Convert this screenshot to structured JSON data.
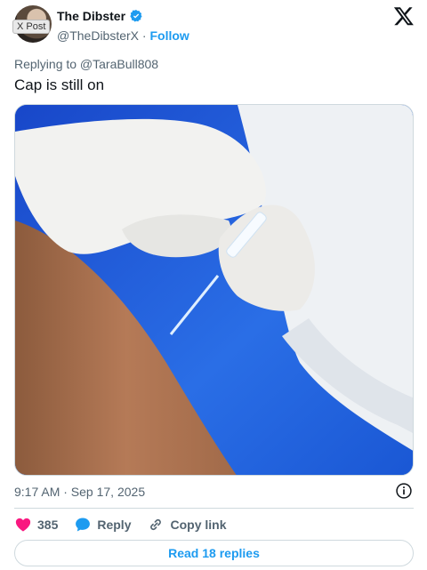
{
  "badge": "X Post",
  "author": {
    "display_name": "The Dibster",
    "handle": "@TheDibsterX",
    "separator": "·",
    "follow_label": "Follow"
  },
  "post": {
    "replying_to": "Replying to @TaraBull808",
    "text": "Cap is still on",
    "timestamp": "9:17 AM · Sep 17, 2025"
  },
  "actions": {
    "likes_count": "385",
    "reply_label": "Reply",
    "copy_link_label": "Copy link"
  },
  "read_replies_label": "Read 18 replies",
  "colors": {
    "accent": "#1d9bf0",
    "like": "#f91880",
    "text_secondary": "#536471",
    "text_primary": "#0f1419"
  },
  "icons": [
    "verified-badge-icon",
    "x-logo-icon",
    "info-icon",
    "heart-icon",
    "reply-bubble-icon",
    "link-icon"
  ]
}
